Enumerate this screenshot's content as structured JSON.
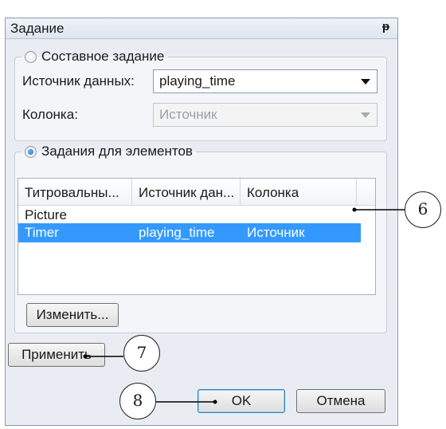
{
  "window": {
    "title": "Задание",
    "pin_icon": "pin-icon"
  },
  "composite_task": {
    "radio_label": "Составное задание",
    "selected": false,
    "data_source_label": "Источник данных:",
    "data_source_value": "playing_time",
    "column_label": "Колонка:",
    "column_value": "Источник"
  },
  "element_tasks": {
    "radio_label": "Задания для элементов",
    "selected": true,
    "columns": [
      "Титровальны...",
      "Источник дан...",
      "Колонка"
    ],
    "rows": [
      {
        "element": "Picture",
        "source": "",
        "column": ""
      },
      {
        "element": "Timer",
        "source": "playing_time",
        "column": "Источник",
        "selected": true
      }
    ],
    "edit_button": "Изменить..."
  },
  "apply_button": "Применить",
  "ok_button": "OK",
  "cancel_button": "Отмена",
  "callouts": [
    "6",
    "7",
    "8"
  ]
}
